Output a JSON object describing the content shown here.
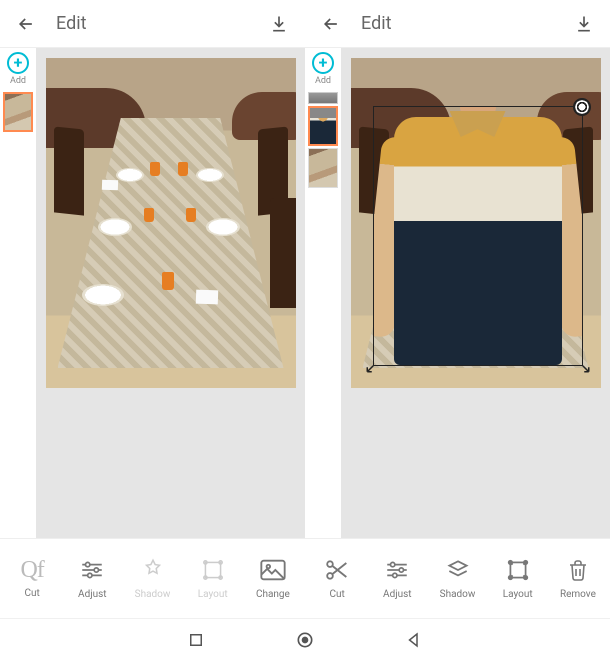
{
  "left": {
    "header": {
      "title": "Edit"
    },
    "sidebar": {
      "add_label": "Add"
    },
    "tools": {
      "brand": "Qf",
      "cut": "Cut",
      "adjust": "Adjust",
      "shadow": "Shadow",
      "layout": "Layout",
      "change": "Change"
    }
  },
  "right": {
    "header": {
      "title": "Edit"
    },
    "sidebar": {
      "add_label": "Add"
    },
    "tools": {
      "cut": "Cut",
      "adjust": "Adjust",
      "shadow": "Shadow",
      "layout": "Layout",
      "remove": "Remove"
    }
  }
}
